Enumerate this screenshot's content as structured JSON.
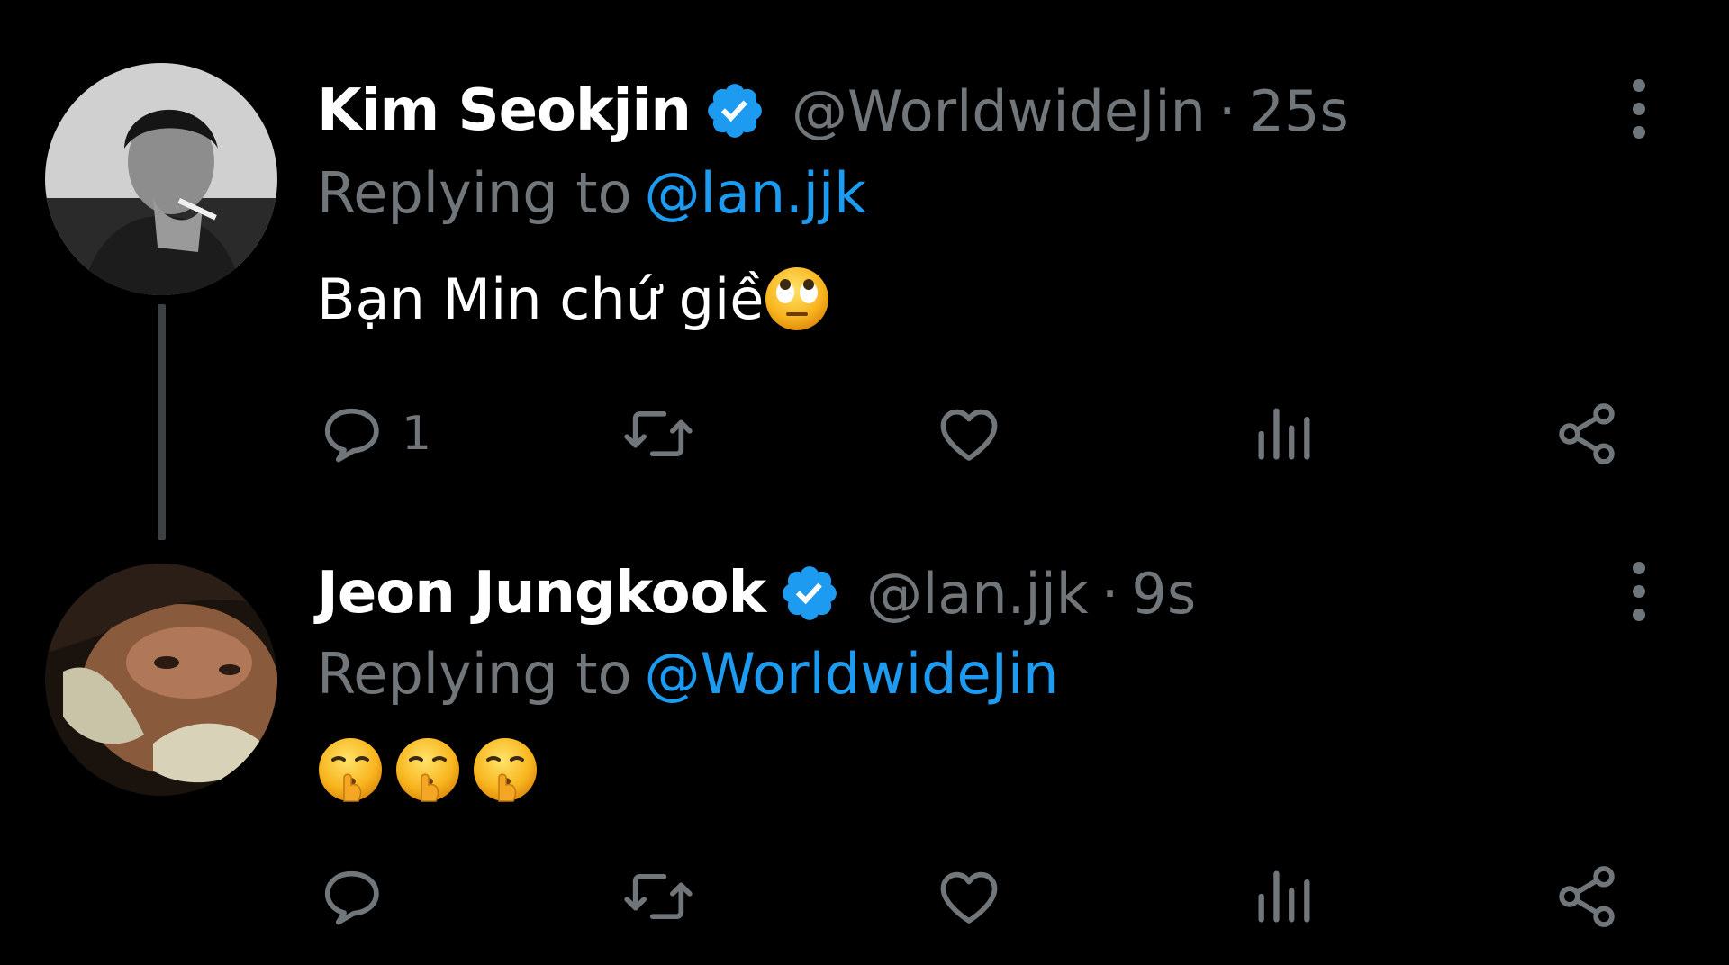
{
  "colors": {
    "background": "#000000",
    "name": "#ffffff",
    "muted": "#71767b",
    "accent": "#1d9bf0",
    "verified": "#1d9bf0"
  },
  "tweets": [
    {
      "display_name": "Kim Seokjin",
      "handle": "@WorldwideJin",
      "separator": "·",
      "time": "25s",
      "replying_label": "Replying to",
      "replying_to": "@lan.jjk",
      "text": "Bạn Min chứ giề",
      "emojis": [
        "face-with-rolling-eyes"
      ],
      "reply_count": "1",
      "icons": [
        "reply-icon",
        "retweet-icon",
        "like-icon",
        "views-icon",
        "share-icon"
      ]
    },
    {
      "display_name": "Jeon Jungkook",
      "handle": "@lan.jjk",
      "separator": "·",
      "time": "9s",
      "replying_label": "Replying to",
      "replying_to": "@WorldwideJin",
      "text": "",
      "emojis": [
        "shushing-face",
        "shushing-face",
        "shushing-face"
      ],
      "reply_count": "",
      "icons": [
        "reply-icon",
        "retweet-icon",
        "like-icon",
        "views-icon",
        "share-icon"
      ]
    }
  ]
}
